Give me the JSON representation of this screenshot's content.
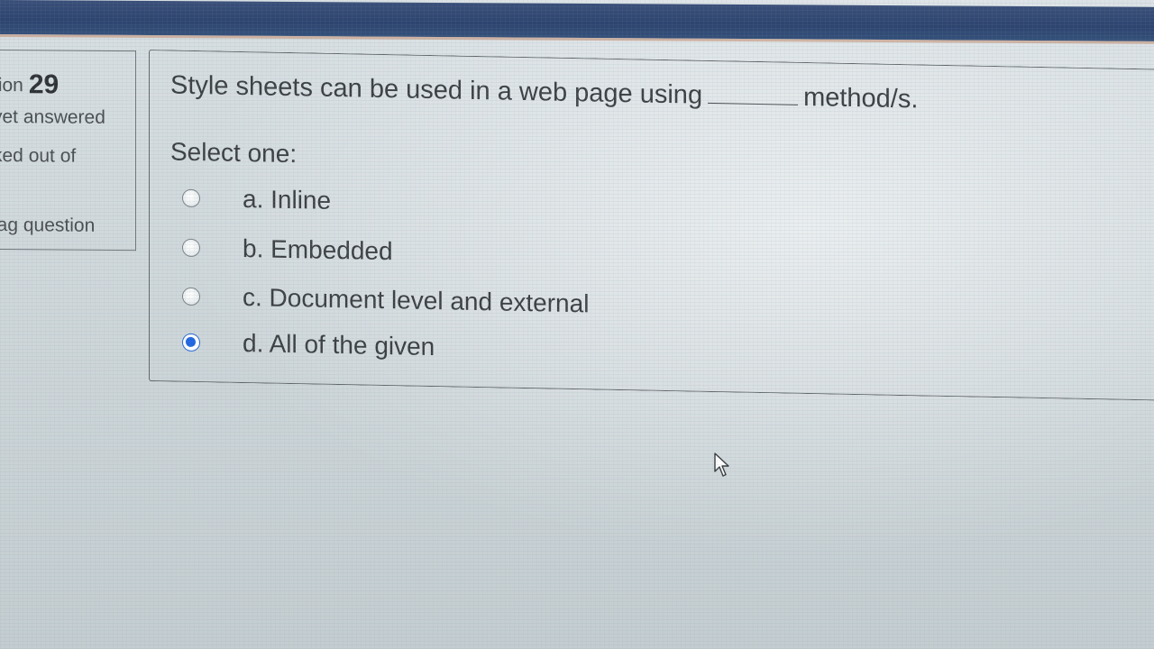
{
  "info": {
    "question_label": "tion",
    "question_number": "29",
    "state": "yet answered",
    "marks": "ked out of",
    "flag": "lag question"
  },
  "question": {
    "text_before": "Style sheets can be used in a web page using",
    "text_after": "method/s.",
    "prompt": "Select one:",
    "options": [
      {
        "label": "a. Inline",
        "selected": false
      },
      {
        "label": "b. Embedded",
        "selected": false
      },
      {
        "label": "c. Document level and external",
        "selected": false
      },
      {
        "label": "d. All of the given",
        "selected": true
      }
    ]
  },
  "colors": {
    "top_bar": "#2d4470",
    "radio_selected": "#1f66e0",
    "text": "#3c4044"
  },
  "icons": {
    "cursor": "mouse-pointer-icon"
  }
}
